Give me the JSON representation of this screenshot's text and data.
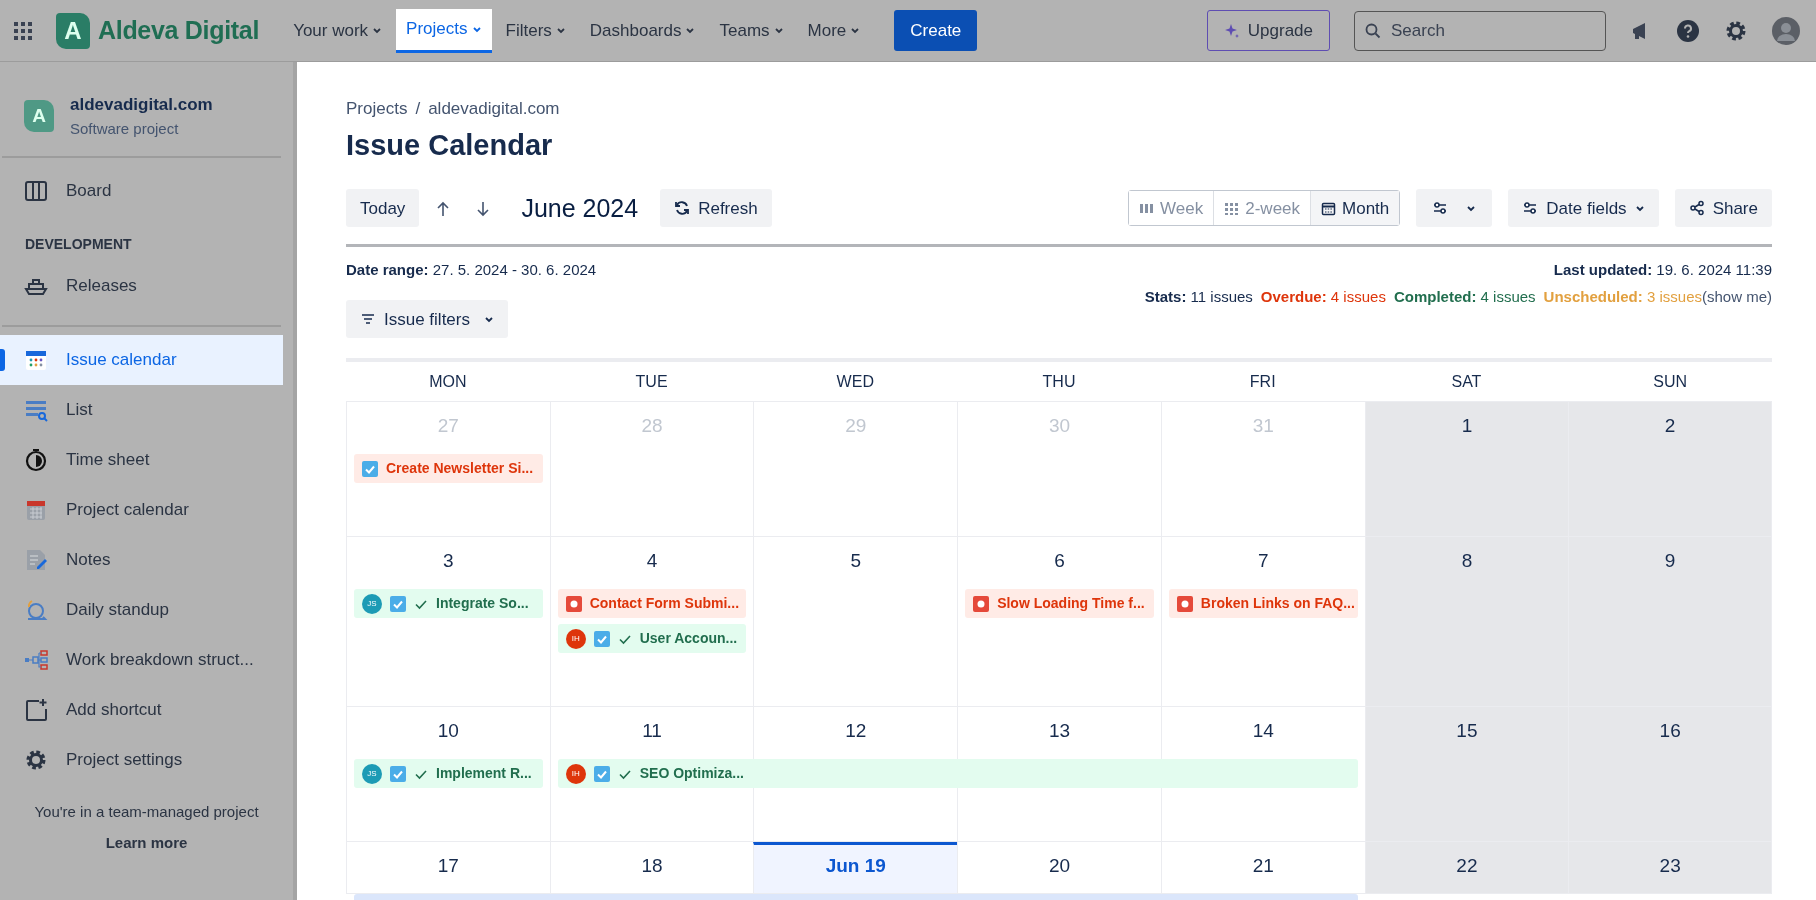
{
  "top_nav": {
    "logo_letter": "A",
    "app_name": "Aldeva Digital",
    "menus": [
      {
        "label": "Your work",
        "selected": false
      },
      {
        "label": "Projects",
        "selected": true
      },
      {
        "label": "Filters",
        "selected": false
      },
      {
        "label": "Dashboards",
        "selected": false
      },
      {
        "label": "Teams",
        "selected": false
      },
      {
        "label": "More",
        "selected": false
      }
    ],
    "create_button": "Create",
    "upgrade_button": "Upgrade",
    "search": {
      "placeholder": "Search"
    }
  },
  "sidebar": {
    "project": {
      "logo_letter": "A",
      "name": "aldevadigital.com",
      "type": "Software project"
    },
    "groups": [
      {
        "items": [
          {
            "label": "Board",
            "selected": false
          }
        ]
      },
      {
        "heading": "DEVELOPMENT",
        "items": [
          {
            "label": "Releases",
            "selected": false
          }
        ]
      },
      {
        "items": [
          {
            "label": "Issue calendar",
            "selected": true
          },
          {
            "label": "List",
            "selected": false
          },
          {
            "label": "Time sheet",
            "selected": false
          },
          {
            "label": "Project calendar",
            "selected": false
          },
          {
            "label": "Notes",
            "selected": false
          },
          {
            "label": "Daily standup",
            "selected": false
          },
          {
            "label": "Work breakdown struct...",
            "selected": false
          },
          {
            "label": "Add shortcut",
            "selected": false
          },
          {
            "label": "Project settings",
            "selected": false
          }
        ]
      }
    ],
    "footer": {
      "note": "You're in a team-managed project",
      "link": "Learn more"
    }
  },
  "breadcrumb": {
    "items": [
      "Projects",
      "aldevadigital.com"
    ],
    "separator": "/"
  },
  "title": "Issue Calendar",
  "toolbar": {
    "today": "Today",
    "period": "June 2024",
    "refresh": "Refresh",
    "views": [
      {
        "label": "Week",
        "selected": false
      },
      {
        "label": "2-week",
        "selected": false
      },
      {
        "label": "Month",
        "selected": true
      }
    ],
    "date_fields": "Date fields",
    "share": "Share"
  },
  "info": {
    "date_range": {
      "label": "Date range:",
      "value": "27. 5. 2024 - 30. 6. 2024"
    },
    "last_updated": {
      "label": "Last updated:",
      "value": "19. 6. 2024 11:39"
    },
    "stats": [
      {
        "label": "Stats:",
        "value": "11 issues",
        "color": "#172b4d"
      },
      {
        "label": "Overdue:",
        "value": "4 issues",
        "color": "#de350b"
      },
      {
        "label": "Completed:",
        "value": "4 issues",
        "color": "#216e4e"
      },
      {
        "label": "Unscheduled:",
        "value": "3 issues",
        "color": "#e2a03f"
      }
    ],
    "show_me": "(show me)"
  },
  "issue_filters": "Issue filters",
  "calendar": {
    "weekdays": [
      "MON",
      "TUE",
      "WED",
      "THU",
      "FRI",
      "SAT",
      "SUN"
    ],
    "weeks": [
      {
        "days": [
          {
            "date": "27",
            "muted": true,
            "weekend": false,
            "today": false,
            "events": [
              {
                "kind": "overdue-task",
                "title": "Create Newsletter Si..."
              }
            ]
          },
          {
            "date": "28",
            "muted": true,
            "weekend": false,
            "today": false
          },
          {
            "date": "29",
            "muted": true,
            "weekend": false,
            "today": false
          },
          {
            "date": "30",
            "muted": true,
            "weekend": false,
            "today": false
          },
          {
            "date": "31",
            "muted": true,
            "weekend": false,
            "today": false
          },
          {
            "date": "1",
            "muted": false,
            "weekend": true,
            "today": false
          },
          {
            "date": "2",
            "muted": false,
            "weekend": true,
            "today": false
          }
        ]
      },
      {
        "days": [
          {
            "date": "3",
            "muted": false,
            "weekend": false,
            "today": false,
            "events": [
              {
                "kind": "done-task",
                "title": "Integrate So...",
                "assignee": {
                  "initials": "JS",
                  "color": "#1d9bb5"
                }
              }
            ]
          },
          {
            "date": "4",
            "muted": false,
            "weekend": false,
            "today": false,
            "events": [
              {
                "kind": "overdue-bug",
                "title": "Contact Form Submi..."
              },
              {
                "kind": "done-task",
                "title": "User Accoun...",
                "assignee": {
                  "initials": "IH",
                  "color": "#de350b"
                }
              }
            ]
          },
          {
            "date": "5",
            "muted": false,
            "weekend": false,
            "today": false
          },
          {
            "date": "6",
            "muted": false,
            "weekend": false,
            "today": false,
            "events": [
              {
                "kind": "overdue-bug",
                "title": "Slow Loading Time f..."
              }
            ]
          },
          {
            "date": "7",
            "muted": false,
            "weekend": false,
            "today": false,
            "events": [
              {
                "kind": "overdue-bug",
                "title": "Broken Links on FAQ..."
              }
            ]
          },
          {
            "date": "8",
            "muted": false,
            "weekend": true,
            "today": false
          },
          {
            "date": "9",
            "muted": false,
            "weekend": true,
            "today": false
          }
        ]
      },
      {
        "days": [
          {
            "date": "10",
            "muted": false,
            "weekend": false,
            "today": false,
            "events": [
              {
                "kind": "done-task",
                "title": "Implement R...",
                "assignee": {
                  "initials": "JS",
                  "color": "#1d9bb5"
                }
              }
            ]
          },
          {
            "date": "11",
            "muted": false,
            "weekend": false,
            "today": false,
            "events": [
              {
                "kind": "done-task",
                "title": "SEO Optimiza...",
                "assignee": {
                  "initials": "IH",
                  "color": "#de350b"
                }
              }
            ]
          },
          {
            "date": "12",
            "muted": false,
            "weekend": false,
            "today": false,
            "events": [
              {
                "kind": "continuation"
              }
            ]
          },
          {
            "date": "13",
            "muted": false,
            "weekend": false,
            "today": false,
            "events": [
              {
                "kind": "continuation"
              }
            ]
          },
          {
            "date": "14",
            "muted": false,
            "weekend": false,
            "today": false,
            "events": [
              {
                "kind": "continuation"
              }
            ]
          },
          {
            "date": "15",
            "muted": false,
            "weekend": true,
            "today": false
          },
          {
            "date": "16",
            "muted": false,
            "weekend": true,
            "today": false
          }
        ]
      },
      {
        "days": [
          {
            "date": "17",
            "muted": false,
            "weekend": false,
            "today": false,
            "events": [
              {
                "kind": "open-task"
              }
            ]
          },
          {
            "date": "18",
            "muted": false,
            "weekend": false,
            "today": false,
            "events": [
              {
                "kind": "continuation"
              }
            ]
          },
          {
            "date": "Jun 19",
            "muted": false,
            "weekend": false,
            "today": true,
            "events": [
              {
                "kind": "continuation"
              }
            ]
          },
          {
            "date": "20",
            "muted": false,
            "weekend": false,
            "today": false,
            "events": [
              {
                "kind": "continuation"
              }
            ]
          },
          {
            "date": "21",
            "muted": false,
            "weekend": false,
            "today": false,
            "events": [
              {
                "kind": "continuation"
              }
            ]
          },
          {
            "date": "22",
            "muted": false,
            "weekend": true,
            "today": false
          },
          {
            "date": "23",
            "muted": false,
            "weekend": true,
            "today": false
          }
        ]
      }
    ]
  }
}
